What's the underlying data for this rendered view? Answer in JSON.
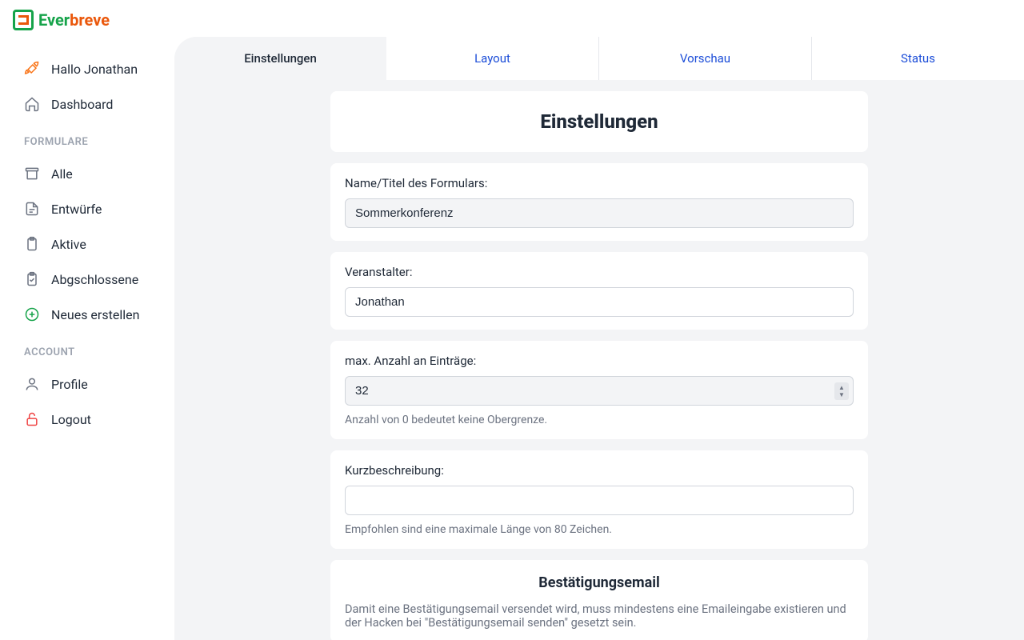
{
  "brand": {
    "part1": "Ever",
    "part2": "breve"
  },
  "sidebar": {
    "greeting": "Hallo Jonathan",
    "dashboard": "Dashboard",
    "section_forms": "FORMULARE",
    "items": {
      "all": "Alle",
      "drafts": "Entwürfe",
      "active": "Aktive",
      "finished": "Abgschlossene",
      "new": "Neues erstellen"
    },
    "section_account": "ACCOUNT",
    "profile": "Profile",
    "logout": "Logout"
  },
  "tabs": {
    "settings": "Einstellungen",
    "layout": "Layout",
    "preview": "Vorschau",
    "status": "Status"
  },
  "page": {
    "title": "Einstellungen"
  },
  "form": {
    "name_label": "Name/Titel des Formulars:",
    "name_value": "Sommerkonferenz",
    "organizer_label": "Veranstalter:",
    "organizer_value": "Jonathan",
    "max_label": "max. Anzahl an Einträge:",
    "max_value": "32",
    "max_help": "Anzahl von 0 bedeutet keine Obergrenze.",
    "short_label": "Kurzbeschreibung:",
    "short_value": "",
    "short_help": "Empfohlen sind eine maximale Länge von 80 Zeichen.",
    "confirm_title": "Bestätigungsemail",
    "confirm_desc": "Damit eine Bestätigungsemail versendet wird, muss mindestens eine Emaileingabe existieren und der Hacken bei \"Bestätigungsemail senden\" gesetzt sein."
  }
}
